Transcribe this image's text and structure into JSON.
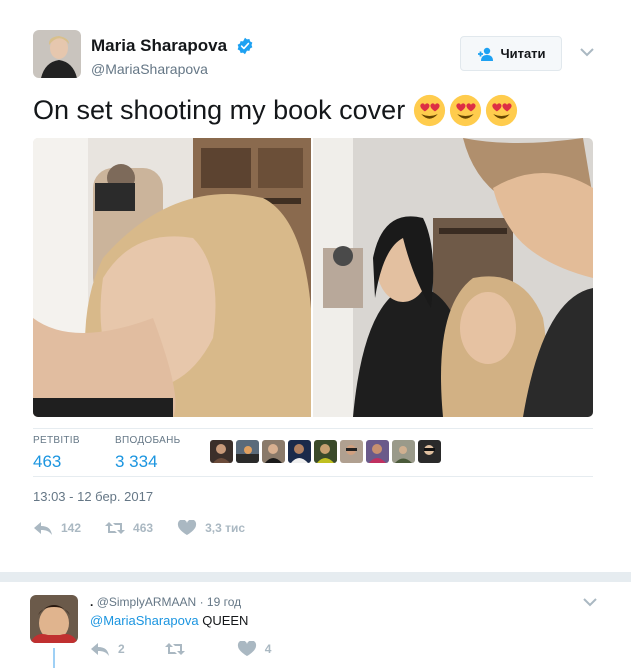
{
  "tweet": {
    "author": {
      "display_name": "Maria Sharapova",
      "handle": "@MariaSharapova",
      "verified": true
    },
    "follow_button": {
      "label": "Читати"
    },
    "text": "On set shooting my book cover",
    "emojis": [
      "heart-eyes-emoji",
      "heart-eyes-emoji",
      "heart-eyes-emoji"
    ],
    "stats": {
      "retweets_label": "РЕТВІТІВ",
      "retweets_value": "463",
      "likes_label": "ВПОДОБАНЬ",
      "likes_value": "3 334"
    },
    "liker_count_shown": 9,
    "timestamp": "13:03 - 12 бер. 2017",
    "actions": {
      "reply_count": "142",
      "retweet_count": "463",
      "like_count": "3,3 тис"
    }
  },
  "reply": {
    "name": ".",
    "handle": "@SimplyARMAAN",
    "separator": "·",
    "time": "19 год",
    "mention": "@MariaSharapova",
    "text": "QUEEN",
    "actions": {
      "reply_count": "2",
      "like_count": "4"
    }
  },
  "colors": {
    "link": "#1b95e0",
    "muted": "#657786",
    "icon": "#aab8c2",
    "thread": "#9fd0f5",
    "verified": "#1da1f2"
  }
}
